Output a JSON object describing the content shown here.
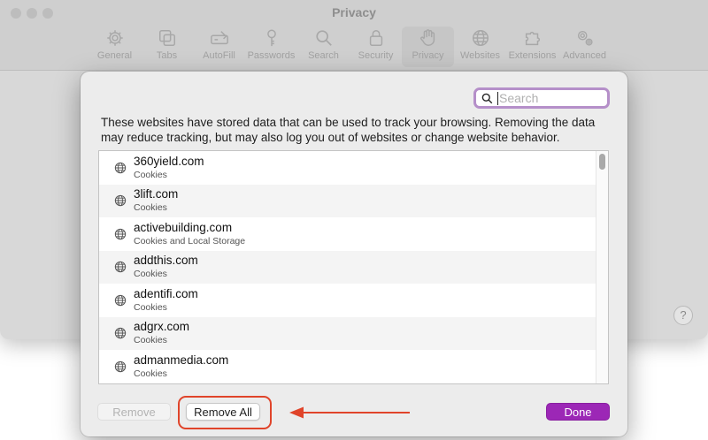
{
  "window": {
    "title": "Privacy"
  },
  "toolbar": {
    "items": [
      {
        "label": "General",
        "icon": "gear-icon"
      },
      {
        "label": "Tabs",
        "icon": "tabs-icon"
      },
      {
        "label": "AutoFill",
        "icon": "autofill-icon"
      },
      {
        "label": "Passwords",
        "icon": "key-icon"
      },
      {
        "label": "Search",
        "icon": "search-icon"
      },
      {
        "label": "Security",
        "icon": "lock-icon"
      },
      {
        "label": "Privacy",
        "icon": "hand-icon",
        "active": true
      },
      {
        "label": "Websites",
        "icon": "globe-icon"
      },
      {
        "label": "Extensions",
        "icon": "puzzle-icon"
      },
      {
        "label": "Advanced",
        "icon": "gears-icon"
      }
    ]
  },
  "help": {
    "label": "?"
  },
  "dialog": {
    "search": {
      "placeholder": "Search",
      "value": ""
    },
    "description": "These websites have stored data that can be used to track your browsing. Removing the data may reduce tracking, but may also log you out of websites or change website behavior.",
    "websites": [
      {
        "domain": "360yield.com",
        "data": "Cookies"
      },
      {
        "domain": "3lift.com",
        "data": "Cookies"
      },
      {
        "domain": "activebuilding.com",
        "data": "Cookies and Local Storage"
      },
      {
        "domain": "addthis.com",
        "data": "Cookies"
      },
      {
        "domain": "adentifi.com",
        "data": "Cookies"
      },
      {
        "domain": "adgrx.com",
        "data": "Cookies"
      },
      {
        "domain": "admanmedia.com",
        "data": "Cookies"
      }
    ],
    "buttons": {
      "remove": "Remove",
      "remove_all": "Remove All",
      "done": "Done"
    }
  },
  "colors": {
    "accent": "#9c27b6",
    "search_focus": "#b58fc9",
    "annotation": "#e0442a"
  }
}
